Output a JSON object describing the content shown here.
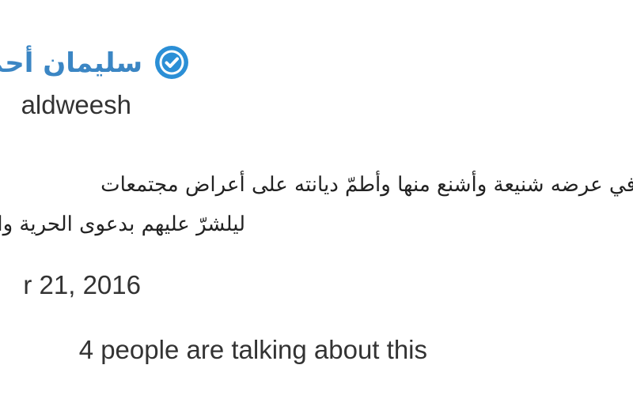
{
  "tweet": {
    "display_name": "سليمان أحمد",
    "handle": "aldweesh",
    "verified_badge": "verified-check-icon",
    "body_line1": "في عرضه شنيعة وأشنع منها وأطمّ ديانته على أعراض مجتمعات",
    "body_line2": "ليلشرّ عليهم بدعوى الحرية والانفتاح",
    "date": "r 21, 2016",
    "talking_about": "4 people are talking about this"
  },
  "colors": {
    "name_blue": "#3b86c4",
    "badge_blue": "#2b8fd6",
    "text": "#333333"
  }
}
